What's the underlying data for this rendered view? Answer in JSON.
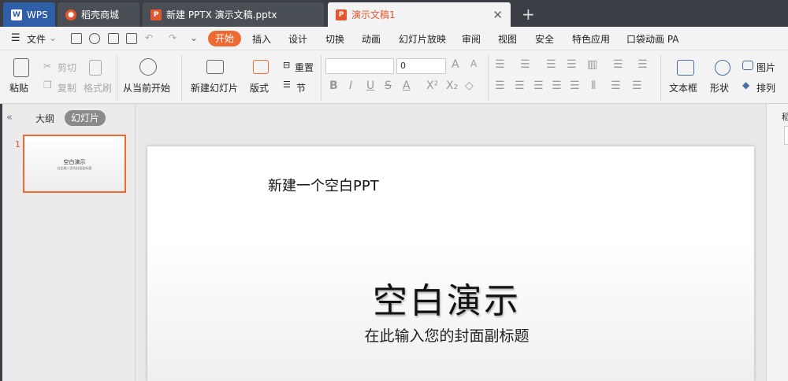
{
  "tabs": {
    "wps": "WPS",
    "daoke": "稻壳商城",
    "pptx": "新建 PPTX 演示文稿.pptx",
    "active": "演示文稿1",
    "close": "✕",
    "add": "+"
  },
  "menu": {
    "file": "文件",
    "items": [
      "开始",
      "插入",
      "设计",
      "切换",
      "动画",
      "幻灯片放映",
      "审阅",
      "视图",
      "安全",
      "特色应用",
      "口袋动画 PA"
    ]
  },
  "ribbon": {
    "paste": "粘贴",
    "cut": "剪切",
    "copy": "复制",
    "format_painter": "格式刷",
    "from_current": "从当前开始",
    "new_slide": "新建幻灯片",
    "layout": "版式",
    "reset": "重置",
    "section": "节",
    "font_size": "0",
    "textbox": "文本框",
    "shape": "形状",
    "picture": "图片",
    "arrange": "排列"
  },
  "panel": {
    "outline": "大纲",
    "slides": "幻灯片",
    "thumb_number": "1",
    "thumb_title": "空白演示",
    "thumb_sub": "在此输入您的封面副标题"
  },
  "slide": {
    "note": "新建一个空白PPT",
    "title": "空白演示",
    "subtitle": "在此输入您的封面副标题"
  },
  "right_panel": {
    "label": "稻"
  },
  "colors": {
    "accent": "#ef6a33",
    "tabbar": "#3b3f45",
    "wps_blue": "#2f5fa7"
  }
}
